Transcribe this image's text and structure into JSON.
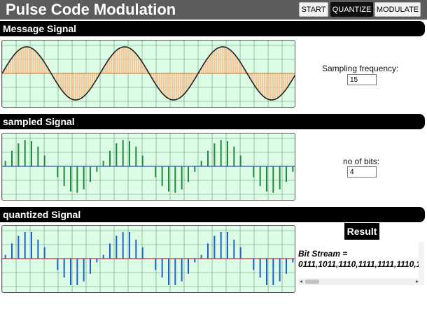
{
  "header": {
    "title": "Pulse Code Modulation"
  },
  "toolbar": {
    "start_label": "START",
    "quantize_label": "QUANTIZE",
    "modulate_label": "MODULATE"
  },
  "sections": {
    "message": {
      "title": "Message Signal"
    },
    "sampled": {
      "title": "sampled Signal"
    },
    "quantized": {
      "title": "quantized Signal"
    }
  },
  "controls": {
    "sampling_label": "Sampling frequency:",
    "sampling_value": "15",
    "bits_label": "no of bits:",
    "bits_value": "4"
  },
  "result": {
    "button_label": "Result",
    "bitstream_label": "Bit Stream    =",
    "bitstream_value": "0111,1011,1110,1111,1111,1110,1"
  },
  "colors": {
    "plot_bg": "#dcfce6",
    "grid": "#2e6a43",
    "sine": "#222222",
    "fill": "#f5c79a",
    "sampled_bar": "#1f8a3a",
    "quantized_bar": "#1f5fd6",
    "axis_sampled": "#3050c0",
    "axis_quantized": "#d03030"
  }
}
